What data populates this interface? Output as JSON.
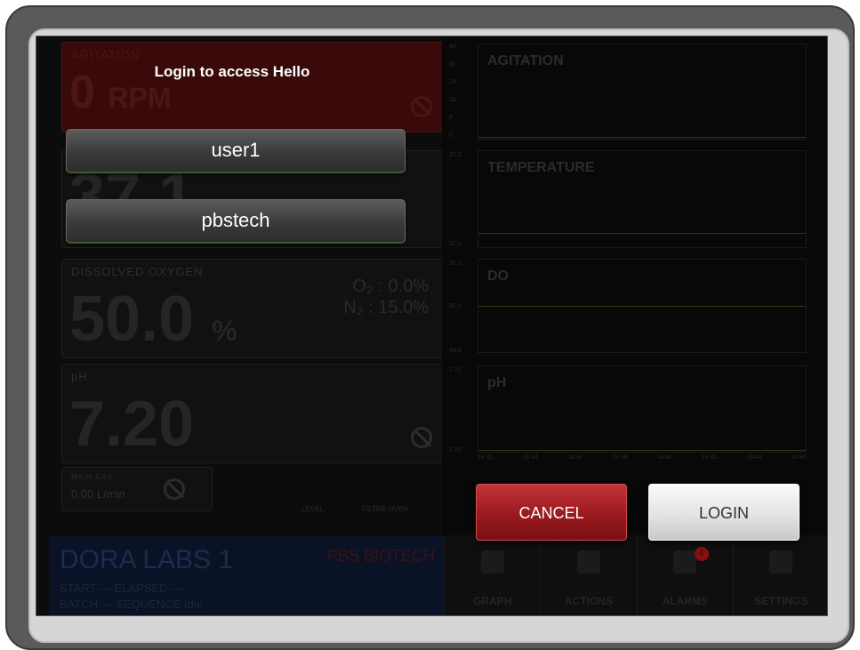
{
  "login": {
    "title": "Login to access Hello",
    "users": [
      "user1",
      "pbstech"
    ],
    "cancel_label": "CANCEL",
    "login_label": "LOGIN"
  },
  "tiles": {
    "agitation": {
      "title": "AGITATION",
      "value": "0",
      "unit": "RPM"
    },
    "temperature": {
      "value": "37.1"
    },
    "dissolved_oxygen": {
      "title": "DISSOLVED OXYGEN",
      "value": "50.0",
      "unit": "%",
      "o2": "O₂ :   0.0%",
      "n2": "N₂ : 15.0%"
    },
    "ph": {
      "title": "pH",
      "value": "7.20"
    },
    "main_gas": {
      "title": "MAIN GAS",
      "value": "0.00 L/min"
    },
    "level_label": "LEVEL",
    "filter_oven_label": "FILTER OVEN"
  },
  "footer": {
    "name": "DORA LABS 1",
    "brand": "PBS BIOTECH",
    "line1": "START — ELAPSED —",
    "line2": "BATCH — SEQUENCE  Idle"
  },
  "graph": {
    "panels": [
      {
        "label": "AGITATION",
        "ticks": [
          "40",
          "32",
          "24",
          "16",
          "8",
          "0"
        ]
      },
      {
        "label": "TEMPERATURE",
        "ticks": [
          "37.2",
          "37.1"
        ]
      },
      {
        "label": "DO",
        "ticks": [
          "50.1",
          "50.0",
          "49.9"
        ]
      },
      {
        "label": "pH",
        "ticks": [
          "7.21",
          "7.20"
        ]
      }
    ],
    "x_ticks": [
      "18:32",
      "18:34",
      "18:36",
      "18:38",
      "18:40",
      "18:42",
      "18:44",
      "18:46"
    ]
  },
  "nav": {
    "items": [
      "GRAPH",
      "ACTIONS",
      "ALARMS",
      "SETTINGS"
    ],
    "alarm_count": "4"
  },
  "colors": {
    "cancel": "#9a1a1f",
    "login": "#e4e4e4",
    "background": "#0c0c0c"
  }
}
